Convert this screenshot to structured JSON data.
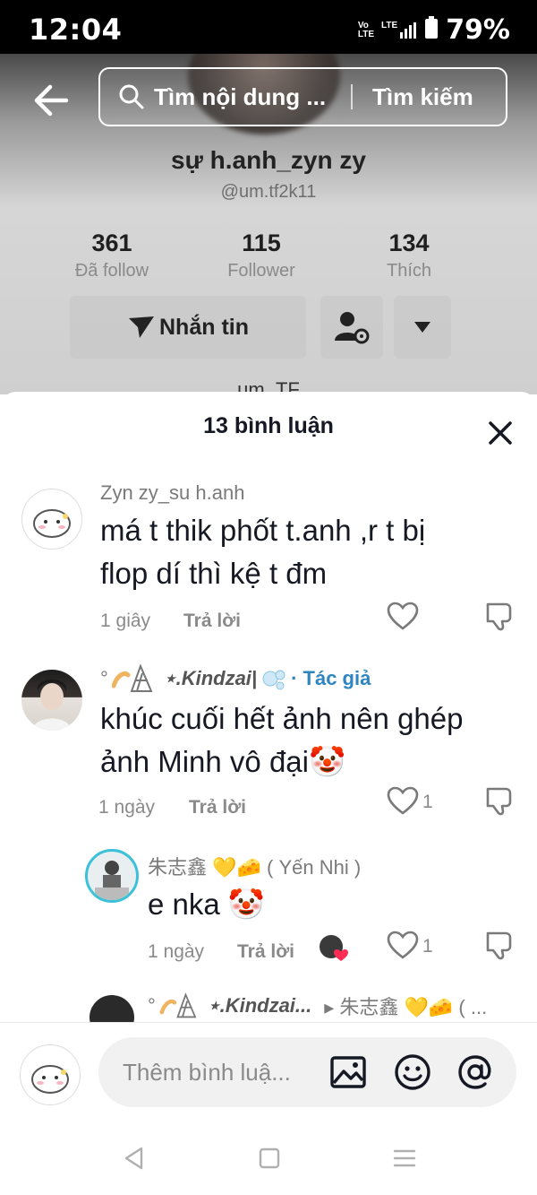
{
  "status_bar": {
    "time": "12:04",
    "volte": "Vo\nLTE",
    "lte": "LTE",
    "battery_pct": "79%"
  },
  "search": {
    "placeholder": "Tìm nội dung ...",
    "button_label": "Tìm kiếm"
  },
  "profile": {
    "name": "sự h.anh_zyn zy",
    "handle": "@um.tf2k11",
    "stats": [
      {
        "value": "361",
        "label": "Đã follow"
      },
      {
        "value": "115",
        "label": "Follower"
      },
      {
        "value": "134",
        "label": "Thích"
      }
    ],
    "message_label": "Nhắn tin",
    "bio": "um_TF"
  },
  "comments_sheet": {
    "title": "13 bình luận",
    "comments": [
      {
        "username": "Zyn zy_su h.anh",
        "text_lines": [
          "má t thik phốt t.anh ,r t bị",
          "flop dí thì kệ t đm"
        ],
        "time": "1 giây",
        "reply_label": "Trả lời",
        "likes": ""
      },
      {
        "username_prefix": "°",
        "username": "⋆.Kindzai|",
        "author_tag": "· Tác giả",
        "text_lines": [
          "khúc cuối hết ảnh nên ghép",
          "ảnh Minh vô đại🤡"
        ],
        "time": "1 ngày",
        "reply_label": "Trả lời",
        "likes": "1"
      },
      {
        "username": "朱志鑫 💛🧀 ( Yến Nhi )",
        "text_lines": [
          "e nka 🤡"
        ],
        "time": "1 ngày",
        "reply_label": "Trả lời",
        "likes": "1"
      },
      {
        "username_prefix": "°",
        "username": "⋆.Kindzai...",
        "reply_to": "▸ 朱志鑫 💛🧀 ( ..."
      }
    ]
  },
  "composer": {
    "placeholder": "Thêm bình luậ..."
  },
  "colors": {
    "author_tag": "#2e86c1",
    "heart_pink": "#fe2c55",
    "sheet_bg": "#ffffff"
  }
}
